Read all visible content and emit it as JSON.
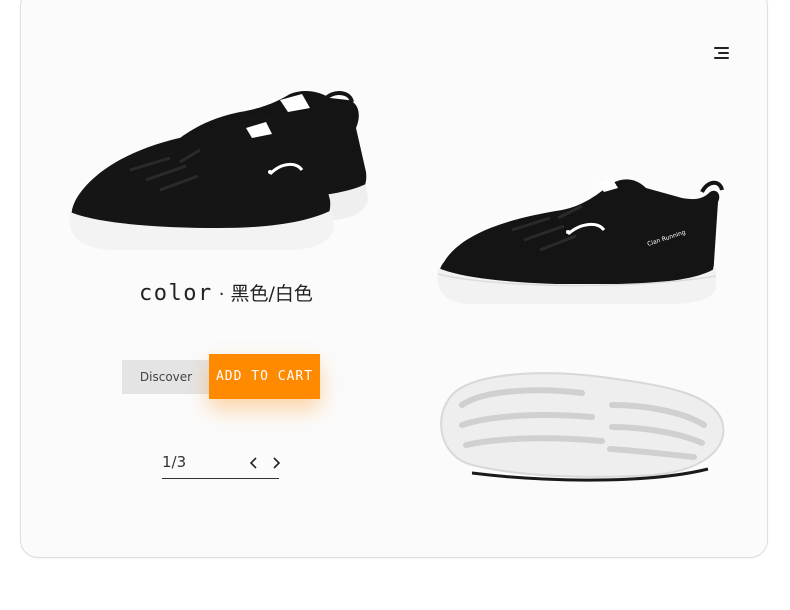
{
  "product": {
    "color_label": "color",
    "color_separator": "·",
    "color_value": "黑色/白色",
    "sole_brand_text": "Cian Running"
  },
  "actions": {
    "discover_label": "Discover",
    "add_to_cart_label": "ADD TO CART"
  },
  "pager": {
    "indicator": "1/3"
  },
  "icons": {
    "menu": "hamburger-menu-icon",
    "prev": "chevron-left-icon",
    "next": "chevron-right-icon"
  },
  "colors": {
    "accent": "#ff8a00",
    "shoe_upper": "#151515",
    "shoe_sole": "#f2f2f2",
    "secondary_button": "#e4e4e4"
  }
}
